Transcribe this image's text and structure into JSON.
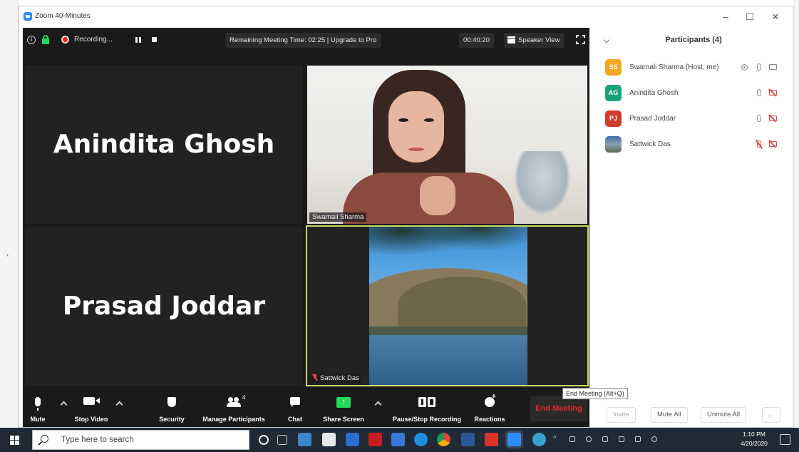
{
  "window": {
    "title": "Zoom 40-Minutes",
    "controls": {
      "minimize": "–",
      "maximize": "☐",
      "close": "✕"
    }
  },
  "meeting": {
    "recording_label": "Recording...",
    "remaining_time": "Remaining Meeting Time: 02:25 | Upgrade to Pro",
    "elapsed": "00:40:20",
    "view_mode": "Speaker View",
    "tiles": [
      {
        "name": "Anindita Ghosh",
        "video": false
      },
      {
        "name": "Swarnali Sharma",
        "video": true
      },
      {
        "name": "Prasad Joddar",
        "video": false
      },
      {
        "name": "Sattwick Das",
        "video": true,
        "muted": true,
        "active_speaker": true
      }
    ]
  },
  "toolbar": {
    "mute": "Mute",
    "stop_video": "Stop Video",
    "security": "Security",
    "manage_participants": "Manage Participants",
    "participant_count": "4",
    "chat": "Chat",
    "share_screen": "Share Screen",
    "pause_stop_recording": "Pause/Stop Recording",
    "reactions": "Reactions",
    "end_meeting": "End Meeting",
    "end_tooltip": "End Meeting (Alt+Q)"
  },
  "panel": {
    "title": "Participants (4)",
    "participants": [
      {
        "initials": "SS",
        "name": "Swarnali Sharma (Host, me)",
        "color": "#f5a623",
        "mic_muted": false,
        "video_off": false,
        "recording": true
      },
      {
        "initials": "AG",
        "name": "Anindita Ghosh",
        "color": "#1aa37a",
        "mic_muted": false,
        "video_off": true
      },
      {
        "initials": "PJ",
        "name": "Prasad Joddar",
        "color": "#d23b2e",
        "mic_muted": false,
        "video_off": true
      },
      {
        "initials": "",
        "name": "Sattwick Das",
        "color": "#6d7f92",
        "mic_muted": true,
        "video_off": true
      }
    ],
    "invite": "Invite",
    "mute_all": "Mute All",
    "unmute_all": "Unmute All",
    "more": "..."
  },
  "taskbar": {
    "search_placeholder": "Type here to search",
    "time": "1:10 PM",
    "date": "4/20/2020"
  }
}
